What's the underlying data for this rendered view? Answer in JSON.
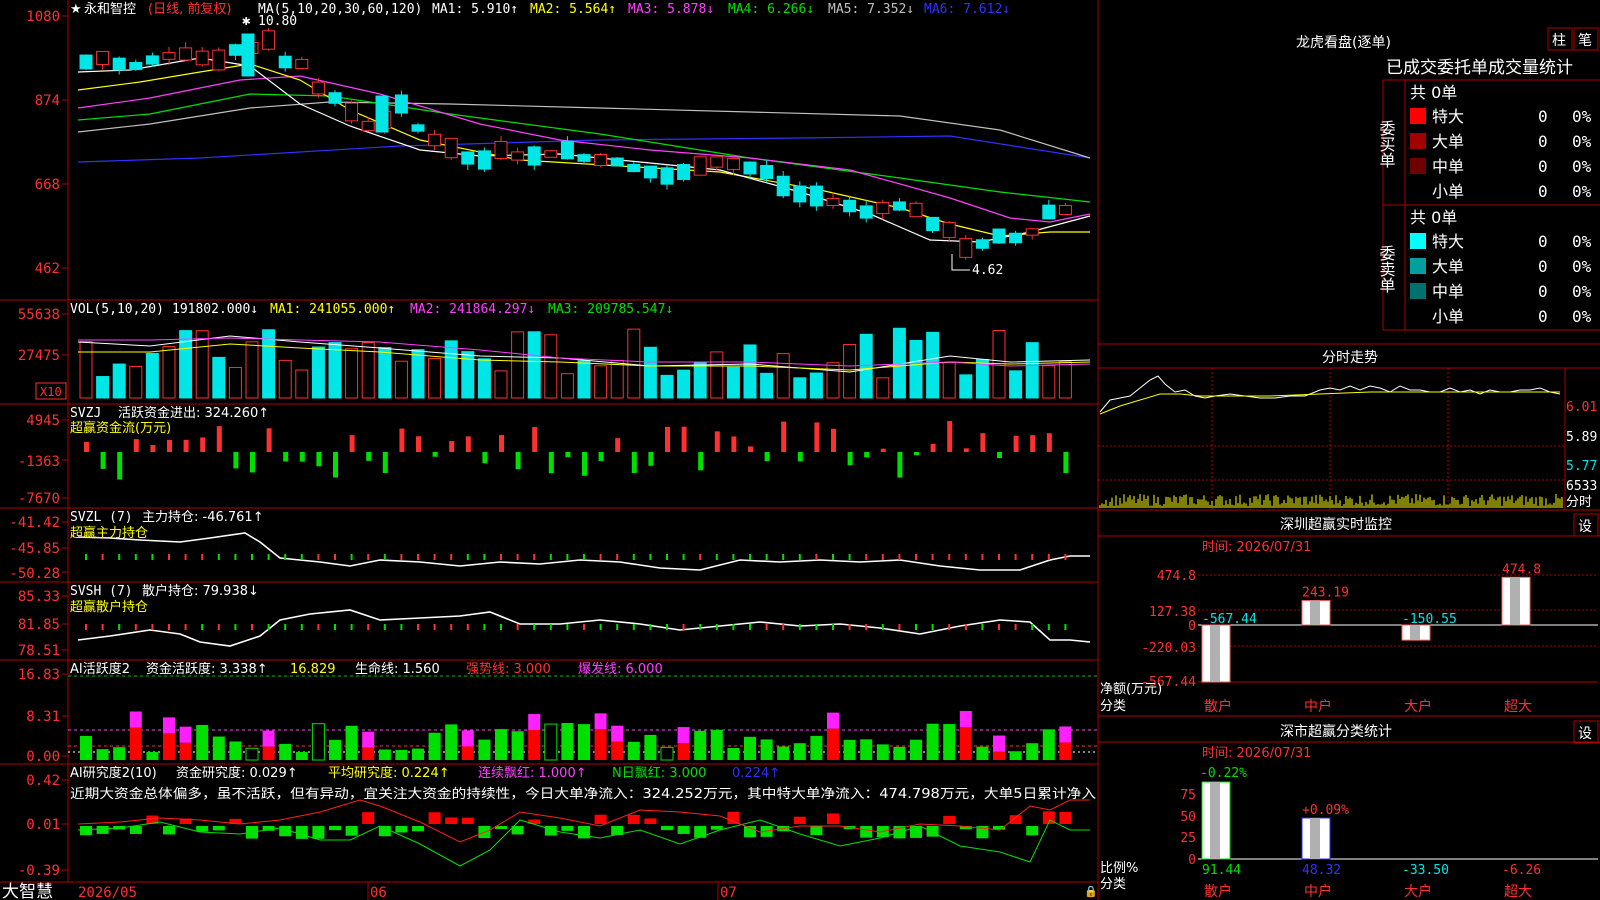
{
  "colors": {
    "up": "#ff3030",
    "down": "#00e5e5",
    "grid": "#b00000",
    "ma_white": "#ffffff",
    "ma_yellow": "#ffff00",
    "ma_magenta": "#ff40ff",
    "ma_green": "#00e000",
    "ma_gray": "#c0c0c0",
    "ma_blue": "#3030ff"
  },
  "stock": {
    "star_icon": "star-icon",
    "name": "永和智控",
    "mode": "(日线, 前复权)"
  },
  "price_panel": {
    "ma_header": "MA(5,10,20,30,60,120)",
    "ma1": "MA1: 5.910↑",
    "ma2": "MA2: 5.564↑",
    "ma3": "MA3: 5.878↓",
    "ma4": "MA4: 6.266↓",
    "ma5": "MA5: 7.352↓",
    "ma6": "MA6: 7.612↓",
    "y_ticks": [
      "1080",
      "874",
      "668",
      "462"
    ],
    "high_marker": "10.80",
    "low_marker": "4.62"
  },
  "vol_panel": {
    "header": "VOL(5,10,20)",
    "value": "191802.000↓",
    "ma1": "MA1: 241055.000↑",
    "ma2": "MA2: 241864.297↓",
    "ma3": "MA3: 209785.547↓",
    "y_ticks": [
      "55638",
      "27475"
    ],
    "unit": "X10"
  },
  "svzj_panel": {
    "header": "SVZJ",
    "label": "活跃资金进出: 324.260↑",
    "sub": "超赢资金流(万元)",
    "y_ticks": [
      "4945",
      "-1363",
      "-7670"
    ]
  },
  "svzl_panel": {
    "header": "SVZL (7)",
    "label": "主力持仓: -46.761↑",
    "sub": "超赢主力持仓",
    "y_ticks": [
      "-41.42",
      "-45.85",
      "-50.28"
    ]
  },
  "svsh_panel": {
    "header": "SVSH (7)",
    "label": "散户持仓: 79.938↓",
    "sub": "超赢散户持仓",
    "y_ticks": [
      "85.33",
      "81.85",
      "78.51"
    ]
  },
  "ai_active_panel": {
    "header": "AI活跃度2",
    "a": "资金活跃度: 3.338↑",
    "b": "16.829",
    "c": "生命线: 1.560",
    "d": "强势线: 3.000",
    "e": "爆发线: 6.000",
    "y_ticks": [
      "16.83",
      "8.31",
      "0.00"
    ]
  },
  "ai_research_panel": {
    "header": "AI研究度2(10)",
    "a": "资金研究度: 0.029↑",
    "b": "平均研究度: 0.224↑",
    "c": "连续飘红: 1.000↑",
    "d": "N日飘红: 3.000",
    "e": "0.224↑",
    "comment": "近期大资金总体偏多，虽不活跃，但有异动，宜关注大资金的持续性，今日大单净流入：324.252万元，其中特大单净流入：474.798万元，大单5日累计净入",
    "y_ticks": [
      "0.42",
      "0.01",
      "-0.39"
    ]
  },
  "bottom_bar": {
    "logo": "大智慧",
    "date1": "2026/05",
    "date2": "06",
    "date3": "07"
  },
  "right": {
    "title": "龙虎看盘(逐单)",
    "btn_zhu": "柱",
    "btn_bi": "笔",
    "header": "已成交委托单成交量统计",
    "buy": {
      "side_label": "委买单",
      "total": "共 0单",
      "rows": [
        {
          "label": "特大",
          "count": "0",
          "pct": "0%",
          "color": "#ff0000"
        },
        {
          "label": "大单",
          "count": "0",
          "pct": "0%",
          "color": "#a00000"
        },
        {
          "label": "中单",
          "count": "0",
          "pct": "0%",
          "color": "#700000"
        },
        {
          "label": "小单",
          "count": "0",
          "pct": "0%",
          "color": "#000000"
        }
      ]
    },
    "sell": {
      "side_label": "委卖单",
      "total": "共 0单",
      "rows": [
        {
          "label": "特大",
          "count": "0",
          "pct": "0%",
          "color": "#00ffff"
        },
        {
          "label": "大单",
          "count": "0",
          "pct": "0%",
          "color": "#00a0a0"
        },
        {
          "label": "中单",
          "count": "0",
          "pct": "0%",
          "color": "#007070"
        },
        {
          "label": "小单",
          "count": "0",
          "pct": "0%",
          "color": "#000000"
        }
      ]
    },
    "intraday": {
      "title": "分时走势",
      "y_ticks": [
        "6.01",
        "5.89",
        "5.77"
      ],
      "vol_label": "6533",
      "time_label": "分时"
    },
    "sz_monitor": {
      "title": "深圳超赢实时监控",
      "settings": "设",
      "time": "时间: 2026/07/31",
      "y_ticks": [
        "474.8",
        "127.38",
        "0",
        "-220.03",
        "-567.44"
      ],
      "y_unit": "净额(万元)",
      "x_label": "分类",
      "categories": [
        "散户",
        "中户",
        "大户",
        "超大"
      ],
      "values": [
        -567.44,
        243.19,
        -150.55,
        474.8
      ],
      "value_labels": [
        "-567.44",
        "243.19",
        "-150.55",
        "474.8"
      ]
    },
    "sz_class": {
      "title": "深市超赢分类统计",
      "settings": "设",
      "time": "时间: 2026/07/31",
      "y_ticks": [
        "75",
        "50",
        "25",
        "0"
      ],
      "y_unit": "比例%",
      "x_label": "分类",
      "categories": [
        "散户",
        "中户",
        "大户",
        "超大"
      ],
      "top_labels": [
        "-0.22%",
        "+0.09%"
      ],
      "bottom_values": [
        "91.44",
        "48.32",
        "-33.50",
        "-6.26"
      ]
    }
  }
}
